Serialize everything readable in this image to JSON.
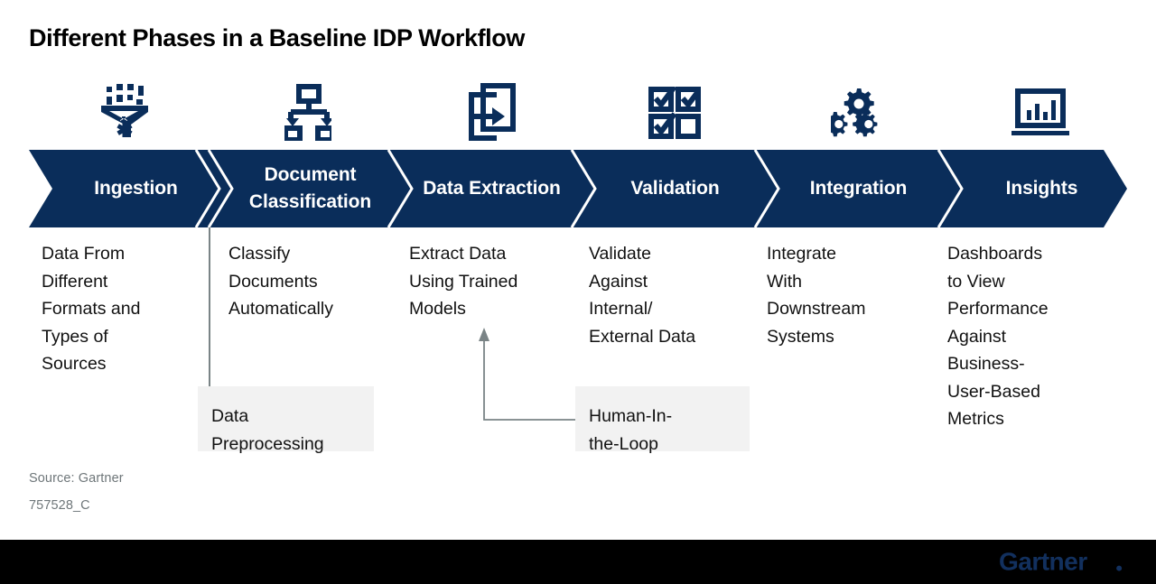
{
  "title": "Different Phases in a Baseline IDP Workflow",
  "colors": {
    "navy": "#0a2d5a",
    "band": "#0a2d5a",
    "callout_bg": "#f2f2f2",
    "connector": "#7a8486",
    "footnote": "#6e7679",
    "footer_bar": "#000000",
    "logo": "#12305e",
    "band_text": "#ffffff",
    "body_text": "#111111"
  },
  "phases": [
    {
      "icon": "funnel-data-filter-icon",
      "label": "Ingestion",
      "description": "Data From\nDifferent\nFormats and\nTypes of\nSources"
    },
    {
      "icon": "hierarchy-classification-icon",
      "label": "Document\nClassification",
      "description": "Classify\nDocuments\nAutomatically"
    },
    {
      "icon": "document-export-arrow-icon",
      "label": "Data\nExtraction",
      "description": "Extract Data\nUsing Trained\nModels"
    },
    {
      "icon": "checkbox-grid-icon",
      "label": "Validation",
      "description": "Validate\nAgainst\nInternal/\nExternal Data"
    },
    {
      "icon": "gears-icon",
      "label": "Integration",
      "description": "Integrate\nWith\nDownstream\nSystems"
    },
    {
      "icon": "laptop-bar-chart-icon",
      "label": "Insights",
      "description": "Dashboards\nto View\nPerformance\nAgainst\nBusiness-\nUser-Based\nMetrics"
    }
  ],
  "callouts": [
    {
      "name": "data-preprocessing",
      "text": "Data\nPreprocessing"
    },
    {
      "name": "human-in-the-loop",
      "text": "Human-In-\nthe-Loop"
    }
  ],
  "footnotes": {
    "source": "Source: Gartner",
    "code": "757528_C"
  },
  "footer": {
    "logo_text": "Gartner",
    "logo_mark": "®"
  }
}
